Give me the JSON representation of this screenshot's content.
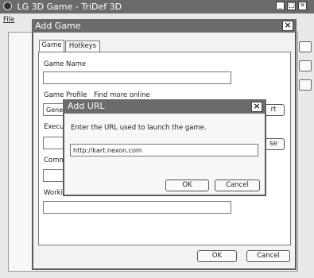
{
  "main_window": {
    "title": "LG 3D Game - TriDef 3D",
    "menu": [
      "File"
    ]
  },
  "add_game": {
    "title": "Add Game",
    "tabs": [
      "Game",
      "Hotkeys"
    ],
    "game_name_label": "Game Name",
    "game_name_value": "",
    "game_profile_label": "Game Profile",
    "find_more_online": "Find more online",
    "profile_value": "Gene",
    "profile_button": "rt",
    "executable_label": "Execu",
    "browse_button": "se",
    "command_label": "Comm",
    "working_label": "Worki",
    "ok_label": "OK",
    "cancel_label": "Cancel"
  },
  "add_url": {
    "title": "Add URL",
    "prompt": "Enter the URL used to launch the game.",
    "url_value": "http://kart.nexon.com",
    "ok_label": "OK",
    "cancel_label": "Cancel"
  },
  "colors": {
    "titlebar": "#6b6b6b",
    "dialog_bg": "#f2f2f2",
    "window_bg": "#e9e9e9"
  }
}
